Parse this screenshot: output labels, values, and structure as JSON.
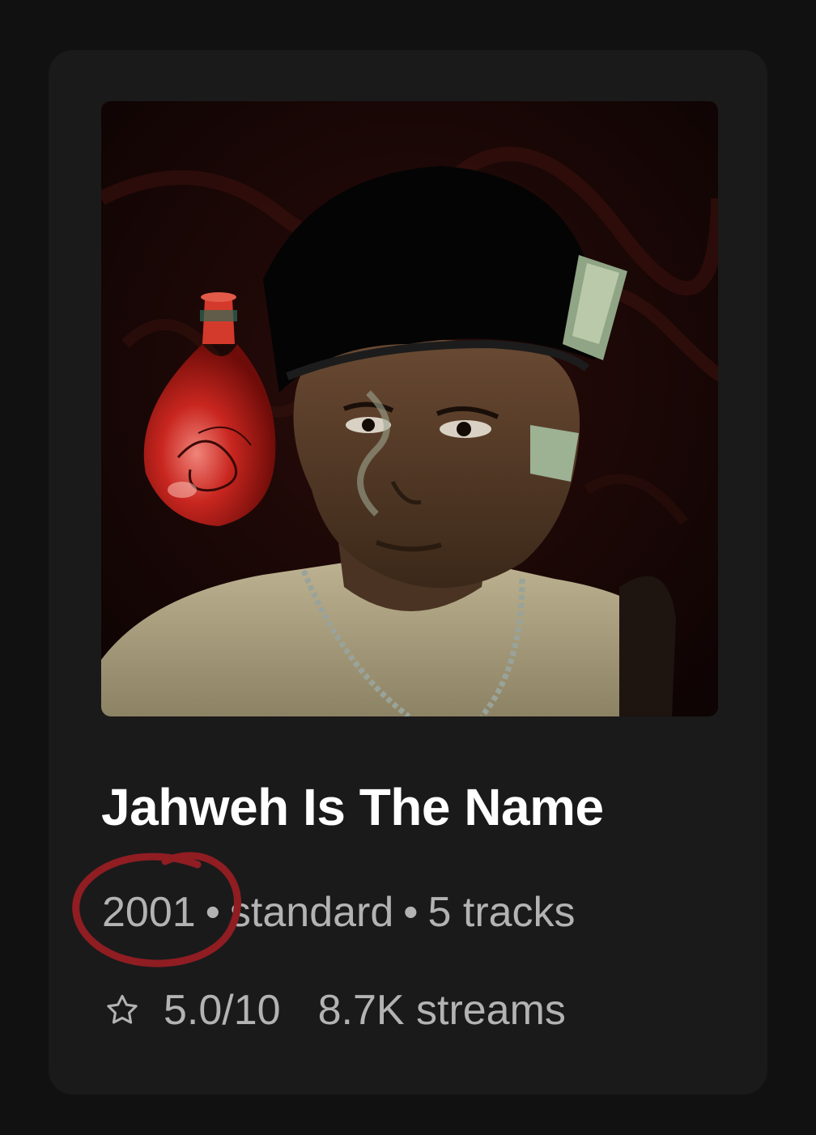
{
  "album": {
    "title": "Jahweh Is The Name",
    "year": "2001",
    "separator": "•",
    "edition": "standard",
    "tracks": "5 tracks",
    "rating": "5.0/10",
    "streams": "8.7K streams"
  },
  "icons": {
    "rating": "star-outline-icon"
  },
  "colors": {
    "background": "#111112",
    "card": "#1a1a1b",
    "title": "#ffffff",
    "meta": "#b3b3b3",
    "annotation_circle": "#8f1d22"
  }
}
